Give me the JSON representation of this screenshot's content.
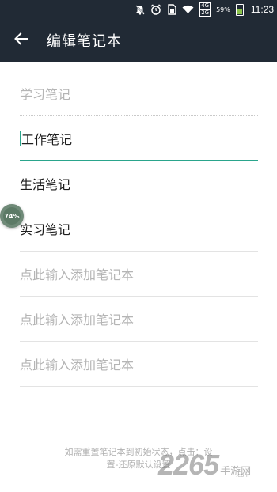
{
  "status_bar": {
    "mute_icon": "notifications-off-icon",
    "alarm_icon": "alarm-icon",
    "sim_icon": "sim-card-icon",
    "wifi_icon": "wifi-icon",
    "signal_label_top": "4G",
    "signal_label_bottom": "2G",
    "battery_percent": "59%",
    "time": "11:23"
  },
  "app_bar": {
    "title": "编辑笔记本",
    "back_icon": "arrow-back-icon"
  },
  "notebooks": [
    {
      "text": "学习笔记",
      "style": "placeholder"
    },
    {
      "text": "工作笔记",
      "style": "active"
    },
    {
      "text": "生活笔记",
      "style": "normal"
    },
    {
      "text": "实习笔记",
      "style": "normal"
    },
    {
      "text": "点此输入添加笔记本",
      "style": "placeholder"
    },
    {
      "text": "点此输入添加笔记本",
      "style": "placeholder"
    },
    {
      "text": "点此输入添加笔记本",
      "style": "placeholder"
    }
  ],
  "floating_bubble": {
    "label": "74%"
  },
  "footer": {
    "line1": "如需重置笔记本到初始状态，点击：设",
    "line2": "置-还原默认设置"
  },
  "watermark": {
    "number": "2265",
    "text": "手游网",
    "domain": ".com"
  },
  "colors": {
    "bar_bg": "#212a35",
    "accent": "#2aa58c"
  }
}
